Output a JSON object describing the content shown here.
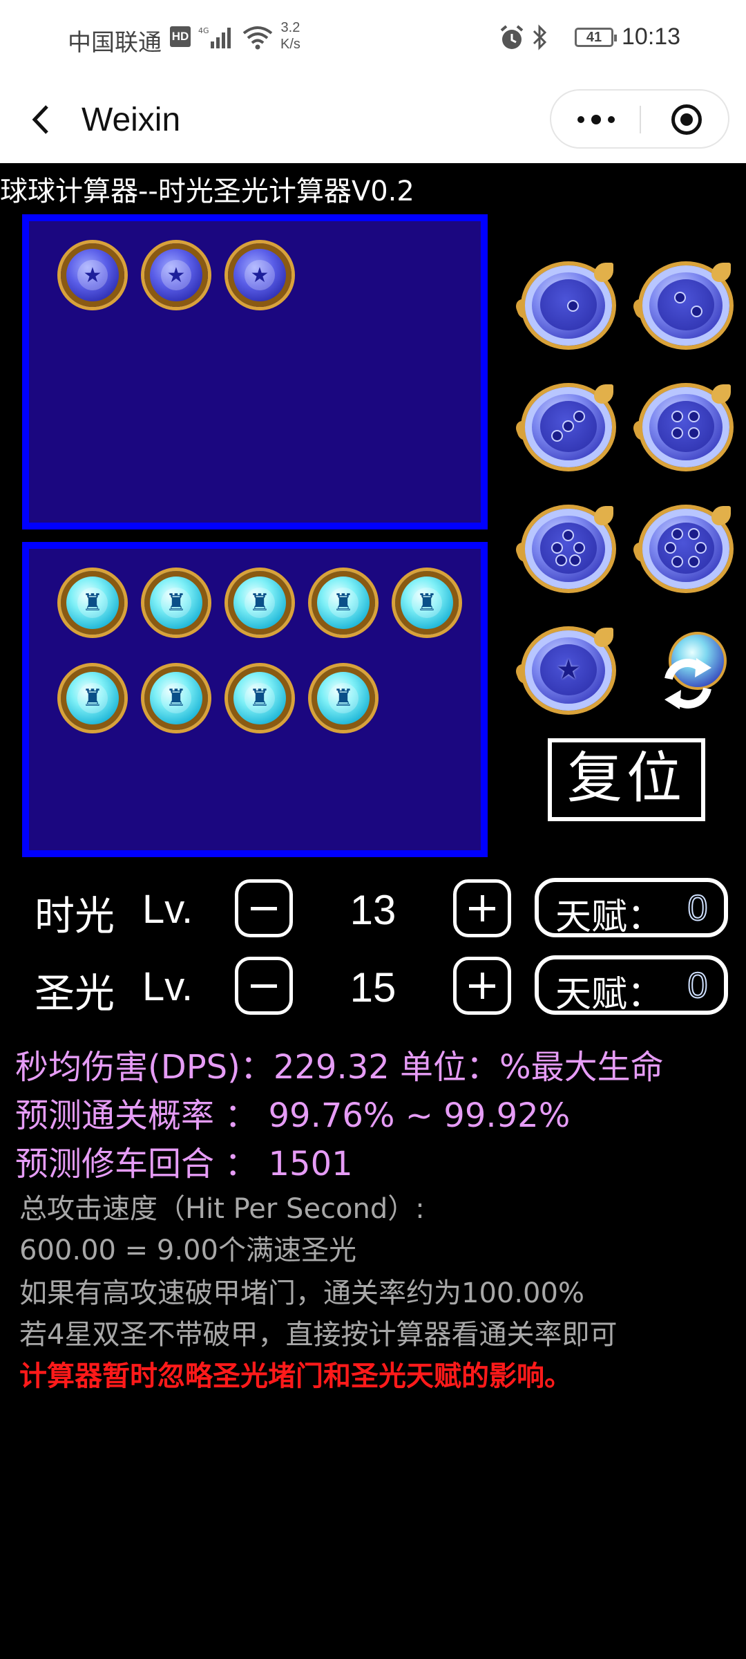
{
  "status_bar": {
    "carrier": "中国联通",
    "hd": "HD",
    "net_speed_value": "3.2",
    "net_speed_unit": "K/s",
    "battery": "41",
    "time": "10:13",
    "icons": [
      "hd-icon",
      "signal-icon",
      "wifi-icon",
      "alarm-icon",
      "bluetooth-icon",
      "battery-icon"
    ]
  },
  "nav": {
    "title": "Weixin",
    "icons": [
      "back-icon",
      "more-icon",
      "close-miniprogram-icon"
    ]
  },
  "app": {
    "title": "球球计算器--时光圣光计算器V0.2",
    "time_box": {
      "ball_count": 3
    },
    "holy_box": {
      "ball_count": 9
    },
    "palette": {
      "balls": [
        "time-ball-1-star",
        "time-ball-2-star",
        "time-ball-3-star",
        "time-ball-4-star",
        "time-ball-5-star",
        "time-ball-6-star",
        "time-ball-7-star"
      ]
    },
    "reset_label": "复位",
    "swap_icon": "swap-refresh-icon",
    "levels": [
      {
        "label": "时光",
        "lv": "Lv.",
        "value": "13",
        "talent_label": "天赋：",
        "talent_value": "0"
      },
      {
        "label": "圣光",
        "lv": "Lv.",
        "value": "15",
        "talent_label": "天赋：",
        "talent_value": "0"
      }
    ],
    "stats": {
      "dps": "秒均伤害(DPS)：229.32   单位：%最大生命",
      "clear_rate": "预测通关概率 ： 99.76% ~ 99.92%",
      "repair_round": "预测修车回合 ： 1501"
    },
    "notes": {
      "speed_title": "总攻击速度（Hit Per Second）:",
      "speed_value": "600.00 = 9.00个满速圣光",
      "note1": "如果有高攻速破甲堵门，通关率约为100.00%",
      "note2": "若4星双圣不带破甲，直接按计算器看通关率即可",
      "warning": "计算器暂时忽略圣光堵门和圣光天赋的影响。"
    },
    "colors": {
      "box_fill": "#1b0780",
      "box_border": "#0000ff",
      "stat_text": "#e69cf6",
      "note_text": "#a8a8a8",
      "warning_text": "#ff1a1a"
    }
  }
}
